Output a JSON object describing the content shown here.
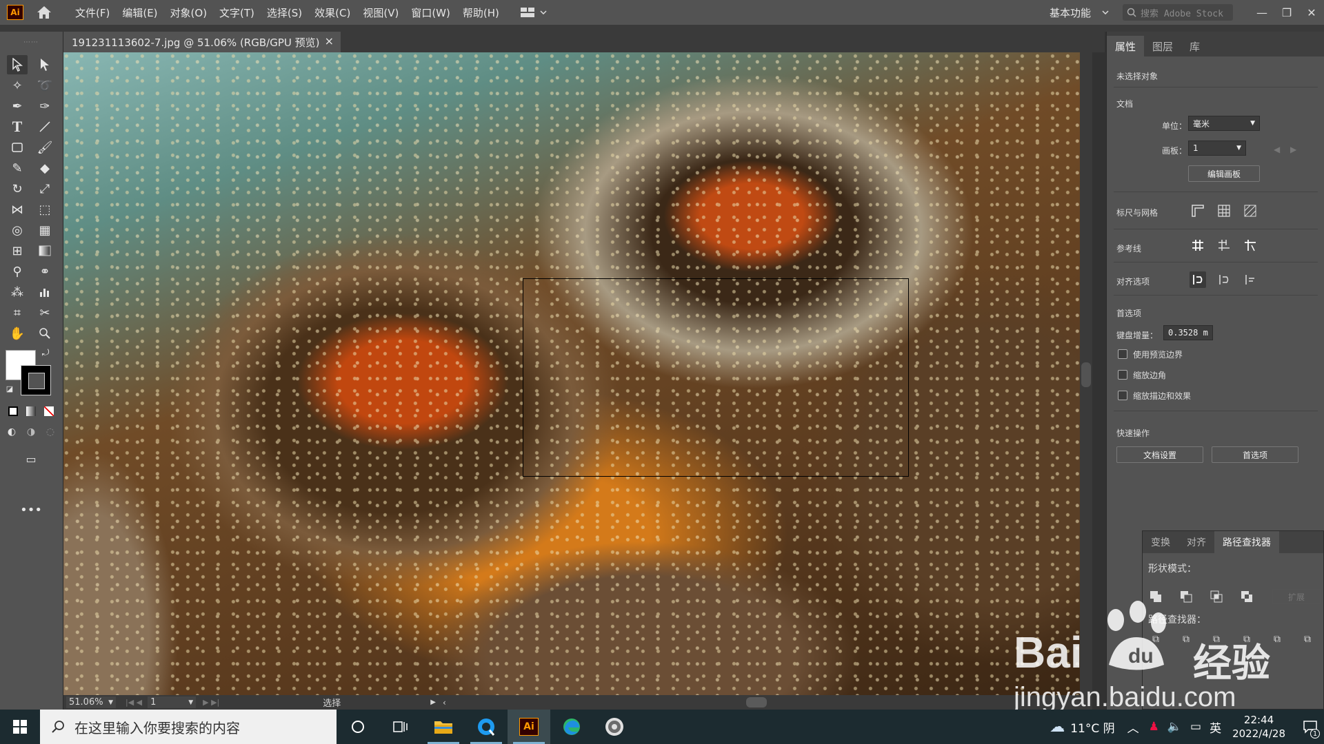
{
  "app": {
    "logo_text": "Ai"
  },
  "menu": [
    "文件(F)",
    "编辑(E)",
    "对象(O)",
    "文字(T)",
    "选择(S)",
    "效果(C)",
    "视图(V)",
    "窗口(W)",
    "帮助(H)"
  ],
  "header": {
    "workspace": "基本功能",
    "stock_search_placeholder": "搜索 Adobe Stock"
  },
  "document": {
    "tab_title": "191231113602-7.jpg @ 51.06% (RGB/GPU 预览)",
    "close_glyph": "×"
  },
  "status": {
    "zoom": "51.06%",
    "artboard": "1",
    "tool": "选择"
  },
  "properties": {
    "tabs": [
      "属性",
      "图层",
      "库"
    ],
    "no_selection": "未选择对象",
    "doc_section": "文档",
    "unit_label": "单位：",
    "unit_value": "毫米",
    "artboard_label": "画板：",
    "artboard_value": "1",
    "edit_artboard": "编辑画板",
    "rulers_grids": "标尺与网格",
    "guides": "参考线",
    "snap_options": "对齐选项",
    "preferences": "首选项",
    "keyboard_increment_label": "键盘增量：",
    "keyboard_increment_value": "0.3528 m",
    "use_preview_bounds": "使用预览边界",
    "scale_corners": "缩放边角",
    "scale_strokes": "缩放描边和效果",
    "quick_actions": "快速操作",
    "doc_setup": "文档设置",
    "prefs_button": "首选项"
  },
  "pathfinder": {
    "tabs": [
      "变换",
      "对齐",
      "路径查找器"
    ],
    "shape_modes": "形状模式：",
    "pathfinders": "路径查找器：",
    "expand": "扩展"
  },
  "taskbar": {
    "search_placeholder": "在这里输入你要搜索的内容",
    "ai_label": "Ai",
    "weather": "11°C 阴",
    "ime": "英",
    "time": "22:44",
    "date": "2022/4/28",
    "notif_count": "1"
  },
  "watermark": {
    "brand": "Bai",
    "brand2": "经验",
    "url": "jingyan.baidu.com"
  }
}
